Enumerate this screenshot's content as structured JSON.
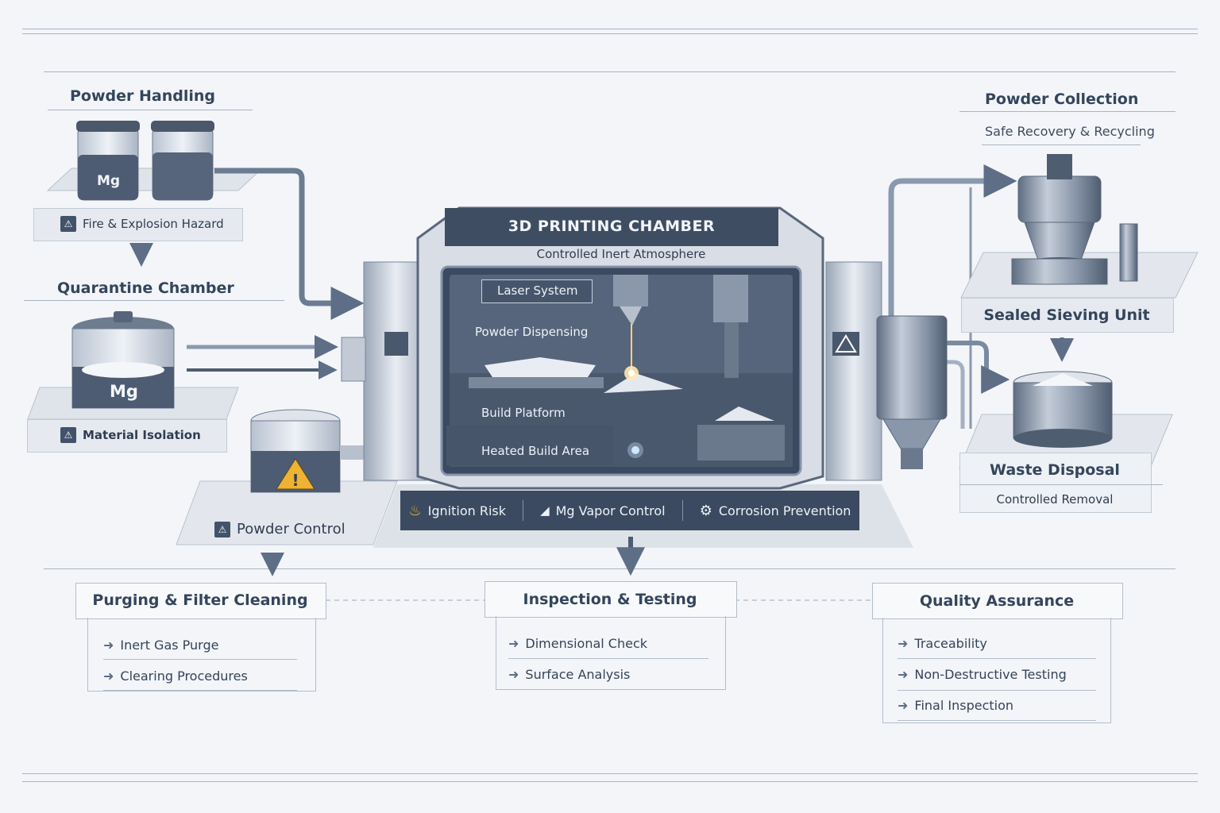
{
  "powder_handling": {
    "title": "Powder Handling",
    "jar_label": "Mg",
    "hazard_label": "Fire & Explosion Hazard"
  },
  "quarantine": {
    "title": "Quarantine Chamber",
    "tank_label": "Mg",
    "isolation_label": "Material Isolation"
  },
  "powder_control": {
    "label": "Powder Control"
  },
  "chamber": {
    "title": "3D PRINTING CHAMBER",
    "subtitle": "Controlled Inert Atmosphere",
    "laser_system": "Laser System",
    "powder_dispensing": "Powder Dispensing",
    "build_platform": "Build Platform",
    "heated_build_area": "Heated Build Area"
  },
  "hazards": {
    "ignition": "Ignition Risk",
    "vapor": "Mg Vapor Control",
    "corrosion": "Corrosion Prevention"
  },
  "powder_collection": {
    "title": "Powder Collection",
    "subtitle": "Safe Recovery & Recycling",
    "sieving": "Sealed Sieving Unit"
  },
  "waste": {
    "title": "Waste Disposal",
    "subtitle": "Controlled Removal"
  },
  "purging": {
    "title": "Purging & Filter Cleaning",
    "items": [
      "Inert Gas Purge",
      "Clearing Procedures"
    ]
  },
  "inspection": {
    "title": "Inspection & Testing",
    "items": [
      "Dimensional Check",
      "Surface Analysis"
    ]
  },
  "quality": {
    "title": "Quality Assurance",
    "items": [
      "Traceability",
      "Non-Destructive Testing",
      "Final Inspection"
    ]
  },
  "colors": {
    "dark_panel": "#3b4a60",
    "accent_warning": "#f0b232",
    "line": "#5d6e86"
  }
}
